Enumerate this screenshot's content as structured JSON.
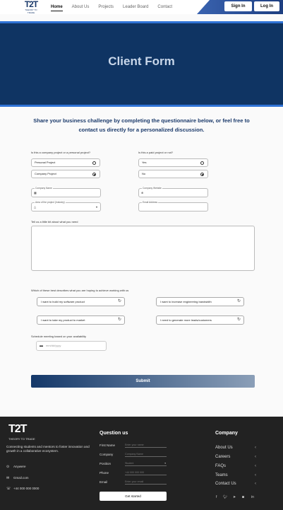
{
  "nav": {
    "logo_mark": "T2T",
    "logo_sub": "THEORY TO TRADE",
    "links": [
      "Home",
      "About Us",
      "Projects",
      "Leader Board",
      "Contact"
    ],
    "signin": "Sign In",
    "login": "Log In"
  },
  "hero": {
    "title": "Client Form"
  },
  "intro": "Share your business challenge by completing the questionnaire below, or feel free to contact us directly for a personalized discussion.",
  "form": {
    "q_project_type": "Is this a company project or a personal project?",
    "project_type_options": [
      "Personal Project",
      "Company Project"
    ],
    "project_type_selected": "Company Project",
    "q_paid": "Is this a paid project or not?",
    "paid_options": [
      "Yes",
      "No"
    ],
    "paid_selected": "No",
    "company_name_label": "Company Name",
    "company_website_label": "Company Website",
    "area_label": "Area of the project (Industry)",
    "email_label": "Email Address",
    "q_tell": "Tell us a little bit about what you need",
    "q_goal": "Which of these best describes what you are hoping to achieve working with us",
    "goals": [
      "I want to build my software product",
      "I want to increase engineering bandwidth",
      "I want to take my product to market",
      "I need to generate more leads/customers"
    ],
    "q_schedule": "Schedule meeting based on your availability",
    "date_placeholder": "mm/dd/yyyy",
    "submit": "Submit"
  },
  "footer": {
    "logo_mark": "T2T",
    "logo_sub": "THEORY TO TRADE",
    "tagline": "Connecting students and mentors to foster innovation and growth in a collaborative ecosystem.",
    "address": "Anywere",
    "email": "Gmail.com",
    "phone": "+44 000 000 0000",
    "question_title": "Question us",
    "q_fields": [
      {
        "label": "First Name",
        "placeholder": "Enter your name"
      },
      {
        "label": "Company",
        "placeholder": "Company Name"
      },
      {
        "label": "Position",
        "placeholder": "Student"
      },
      {
        "label": "Phone",
        "placeholder": "+44 000 000 000"
      },
      {
        "label": "Email",
        "placeholder": "Enter your email"
      }
    ],
    "get_started": "Get started",
    "company_title": "Company",
    "company_links": [
      "About Us",
      "Careers",
      "FAQs",
      "Teams",
      "Contact Us"
    ],
    "socials": [
      "facebook-icon",
      "twitter-icon",
      "telegram-icon",
      "instagram-icon",
      "linkedin-icon"
    ]
  }
}
